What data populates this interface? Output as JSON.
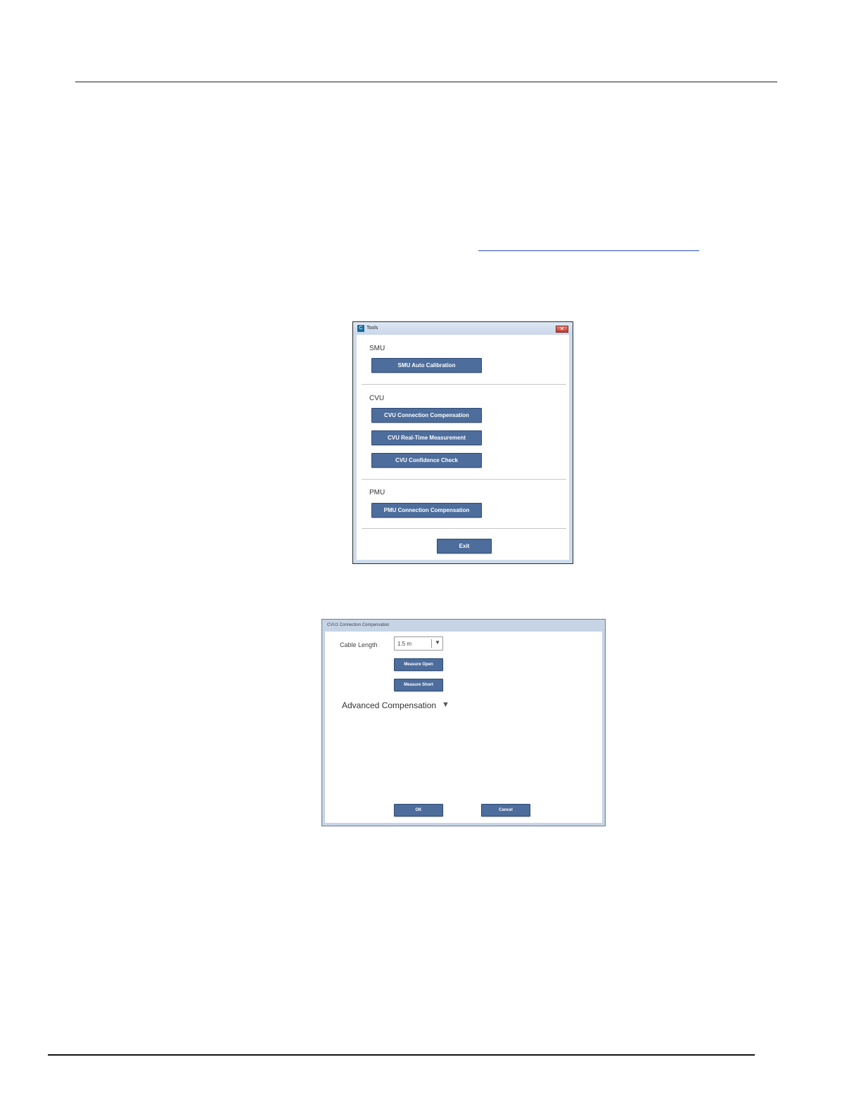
{
  "tools_dialog": {
    "app_icon": "C",
    "title": "Tools",
    "close_label": "✕",
    "sections": {
      "smu": {
        "label": "SMU",
        "buttons": [
          "SMU Auto Calibration"
        ]
      },
      "cvu": {
        "label": "CVU",
        "buttons": [
          "CVU Connection Compensation",
          "CVU Real-Time Measurement",
          "CVU Confidence Check"
        ]
      },
      "pmu": {
        "label": "PMU",
        "buttons": [
          "PMU Connection Compensation"
        ]
      }
    },
    "exit_label": "Exit"
  },
  "cvu_dialog": {
    "title": "CVU1 Connection Compensation",
    "cable_length_label": "Cable Length",
    "cable_length_value": "1.5 m",
    "dropdown_arrow": "▼",
    "measure_open_label": "Measure Open",
    "measure_short_label": "Measure Short",
    "advanced_label": "Advanced Compensation",
    "advanced_arrow": "▼",
    "ok_label": "OK",
    "cancel_label": "Cancel"
  },
  "colors": {
    "button_bg": "#4d6d9c",
    "window_frame": "#cfdcec",
    "link": "#2a4fd6"
  }
}
